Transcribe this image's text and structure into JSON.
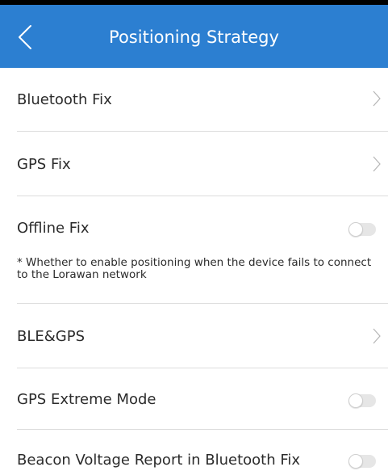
{
  "header": {
    "title": "Positioning Strategy",
    "back_icon": "chevron-left-icon",
    "background_color": "#2c7fd1"
  },
  "items": [
    {
      "label": "Bluetooth Fix",
      "control": "chevron"
    },
    {
      "label": "GPS Fix",
      "control": "chevron"
    },
    {
      "label": "Offline Fix",
      "control": "toggle",
      "toggle_on": false
    },
    {
      "label": "BLE&GPS",
      "control": "chevron"
    },
    {
      "label": "GPS Extreme Mode",
      "control": "toggle",
      "toggle_on": false
    },
    {
      "label": "Beacon Voltage Report in Bluetooth Fix",
      "control": "toggle",
      "toggle_on": false
    }
  ],
  "offline_note": "* Whether to enable positioning when the device fails to connect to the Lorawan network"
}
